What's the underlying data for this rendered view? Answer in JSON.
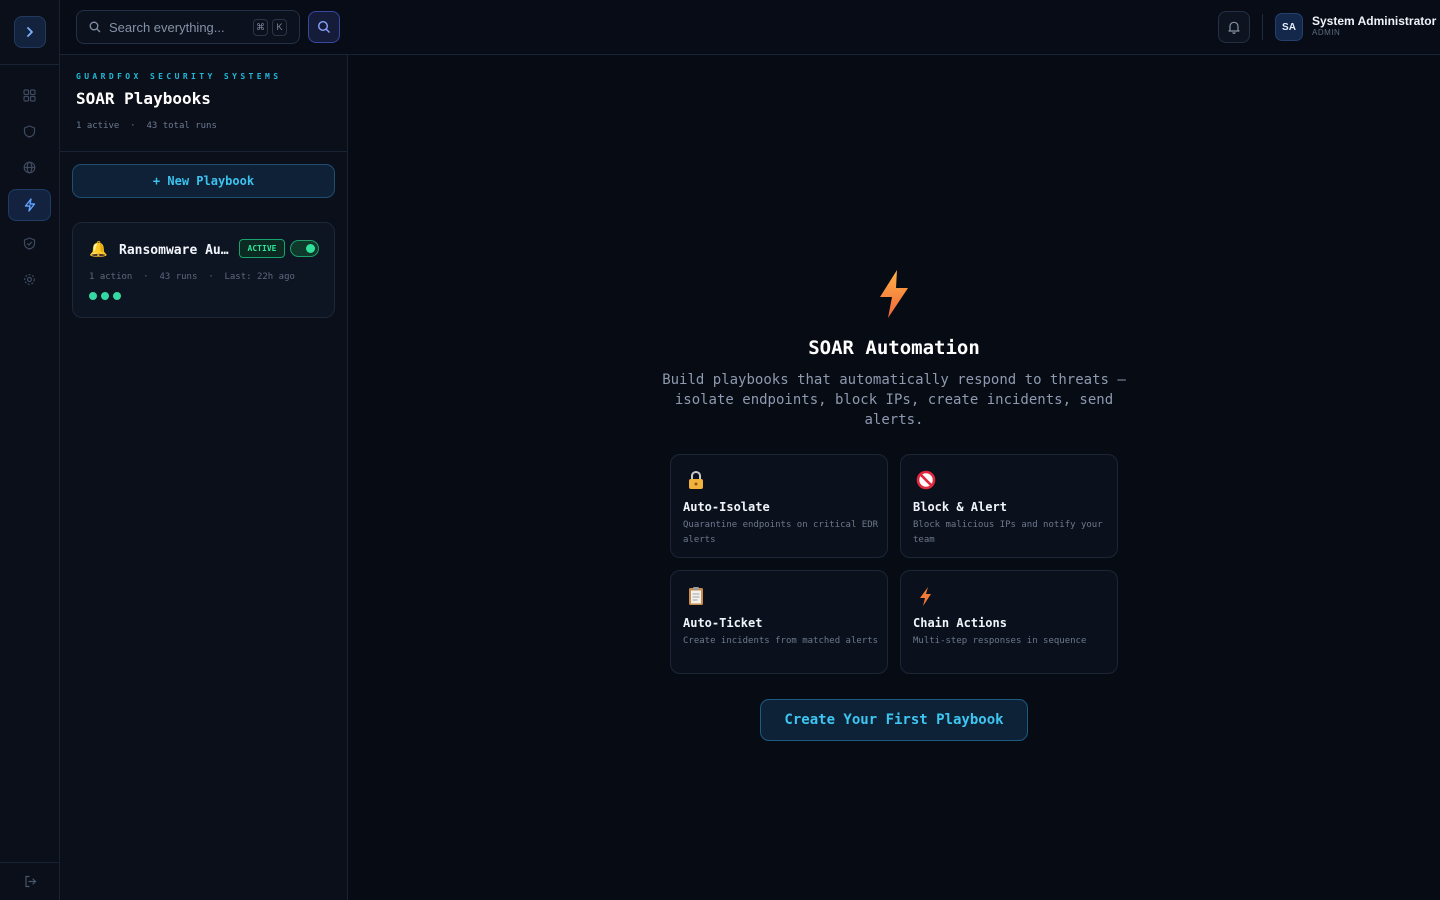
{
  "topbar": {
    "search_placeholder": "Search everything...",
    "kbd_cmd": "⌘",
    "kbd_key": "K"
  },
  "user": {
    "initials": "SA",
    "name": "System Administrator",
    "role": "ADMIN"
  },
  "rail": {
    "items": [
      {
        "icon": "grid-icon",
        "active": false
      },
      {
        "icon": "shield-icon",
        "active": false
      },
      {
        "icon": "globe-icon",
        "active": false
      },
      {
        "icon": "lightning-icon",
        "active": true
      },
      {
        "icon": "shield-check-icon",
        "active": false
      },
      {
        "icon": "gear-icon",
        "active": false
      }
    ]
  },
  "panel": {
    "brand": "GUARDFOX SECURITY SYSTEMS",
    "title": "SOAR Playbooks",
    "stats": "1 active  ·  43 total runs",
    "new_button": "+ New Playbook"
  },
  "playbooks": [
    {
      "emoji": "🔔",
      "name": "Ransomware Auto-Isolate",
      "status": "ACTIVE",
      "enabled": true,
      "meta": "1 action  ·  43 runs  ·  Last: 22h ago"
    }
  ],
  "empty_state": {
    "title": "SOAR Automation",
    "description": "Build playbooks that automatically respond to threats — isolate endpoints, block IPs, create incidents, send alerts.",
    "cta": "Create Your First Playbook",
    "features": [
      {
        "icon": "lock-icon",
        "title": "Auto-Isolate",
        "desc": "Quarantine endpoints on critical EDR alerts"
      },
      {
        "icon": "block-icon",
        "title": "Block & Alert",
        "desc": "Block malicious IPs and notify your team"
      },
      {
        "icon": "clipboard-icon",
        "title": "Auto-Ticket",
        "desc": "Create incidents from matched alerts"
      },
      {
        "icon": "lightning-icon",
        "title": "Chain Actions",
        "desc": "Multi-step responses in sequence"
      }
    ]
  },
  "colors": {
    "accent": "#3cc2ef",
    "active_green": "#2ee59d",
    "background": "#070b14"
  }
}
